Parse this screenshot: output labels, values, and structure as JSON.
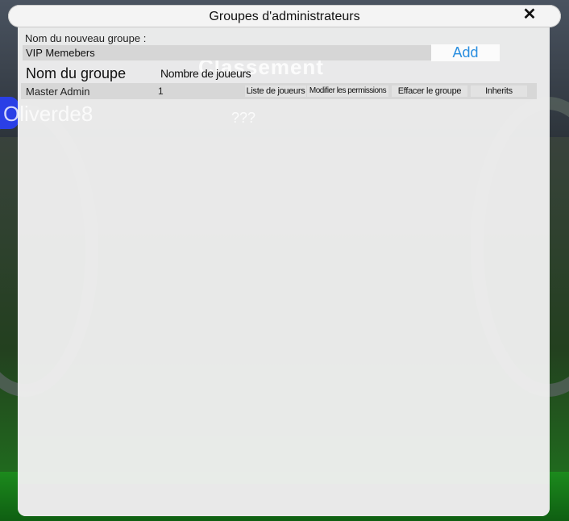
{
  "dialog": {
    "title": "Groupes d'administrateurs",
    "close_icon": "close-icon"
  },
  "background": {
    "ghost_title": "Classement",
    "ghost_player": "Oliverde8",
    "ghost_rank": "???"
  },
  "new_group": {
    "label": "Nom du nouveau groupe :",
    "input_value": "VIP Memebers",
    "add_label": "Add"
  },
  "table": {
    "headers": {
      "name": "Nom du groupe",
      "players": "Nombre de joueurs"
    },
    "rows": [
      {
        "name": "Master Admin",
        "players": "1",
        "actions": {
          "players_list": "Liste de joueurs",
          "permissions": "Modifier les permissions",
          "delete": "Effacer le groupe",
          "inherits": "Inherits"
        }
      }
    ]
  },
  "colors": {
    "accent": "#2b8fe0",
    "panel": "#f0f0f0",
    "row": "#d7d7d7"
  }
}
